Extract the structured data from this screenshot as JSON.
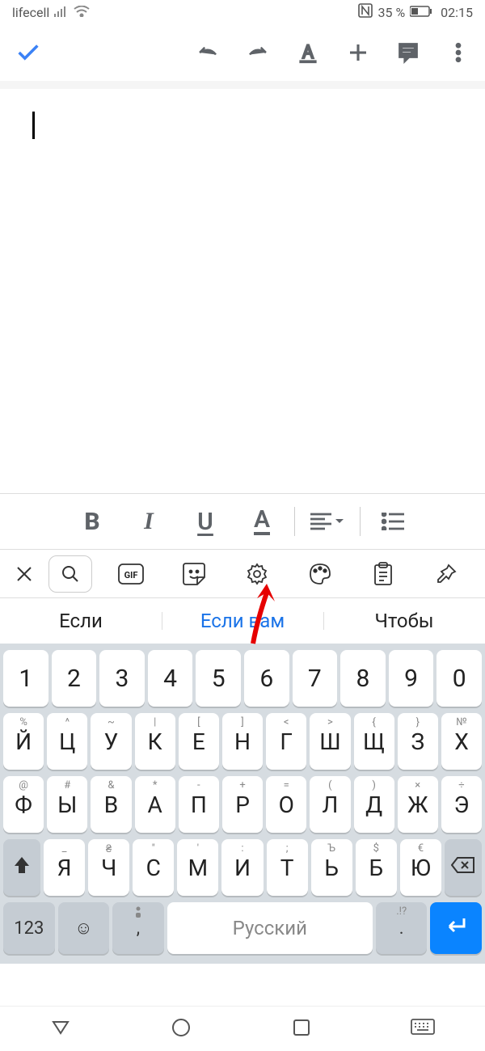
{
  "status_bar": {
    "carrier": "lifecell",
    "battery_percent": "35 %",
    "time": "02:15"
  },
  "format_bar": {
    "bold": "B",
    "italic": "I",
    "underline": "U",
    "color": "A"
  },
  "suggestions": {
    "s1": "Если",
    "s2": "Если вам",
    "s3": "Чтобы"
  },
  "keyboard": {
    "numbers": [
      "1",
      "2",
      "3",
      "4",
      "5",
      "6",
      "7",
      "8",
      "9",
      "0"
    ],
    "row2": [
      {
        "m": "Й",
        "h": "%"
      },
      {
        "m": "Ц",
        "h": "^"
      },
      {
        "m": "У",
        "h": "~"
      },
      {
        "m": "К",
        "h": "|"
      },
      {
        "m": "Е",
        "h": "["
      },
      {
        "m": "Н",
        "h": "]"
      },
      {
        "m": "Г",
        "h": "<"
      },
      {
        "m": "Ш",
        "h": ">"
      },
      {
        "m": "Щ",
        "h": "{"
      },
      {
        "m": "З",
        "h": "}"
      },
      {
        "m": "Х",
        "h": "№"
      }
    ],
    "row3": [
      {
        "m": "Ф",
        "h": "@"
      },
      {
        "m": "Ы",
        "h": "#"
      },
      {
        "m": "В",
        "h": "&"
      },
      {
        "m": "А",
        "h": "*"
      },
      {
        "m": "П",
        "h": "-"
      },
      {
        "m": "Р",
        "h": "+"
      },
      {
        "m": "О",
        "h": "="
      },
      {
        "m": "Л",
        "h": "("
      },
      {
        "m": "Д",
        "h": ")"
      },
      {
        "m": "Ж",
        "h": "×"
      },
      {
        "m": "Э",
        "h": "÷"
      }
    ],
    "row4": [
      {
        "m": "Я",
        "h": "_"
      },
      {
        "m": "Ч",
        "h": "₴"
      },
      {
        "m": "С",
        "h": "\""
      },
      {
        "m": "М",
        "h": "'"
      },
      {
        "m": "И",
        "h": ":"
      },
      {
        "m": "Т",
        "h": ";"
      },
      {
        "m": "Ь",
        "h": "Ъ"
      },
      {
        "m": "Б",
        "h": "$"
      },
      {
        "m": "Ю",
        "h": "€"
      }
    ],
    "bottom": {
      "sym": "123",
      "comma": ",",
      "space": "Русский",
      "period": ".",
      "period_hint": ".!?"
    }
  }
}
